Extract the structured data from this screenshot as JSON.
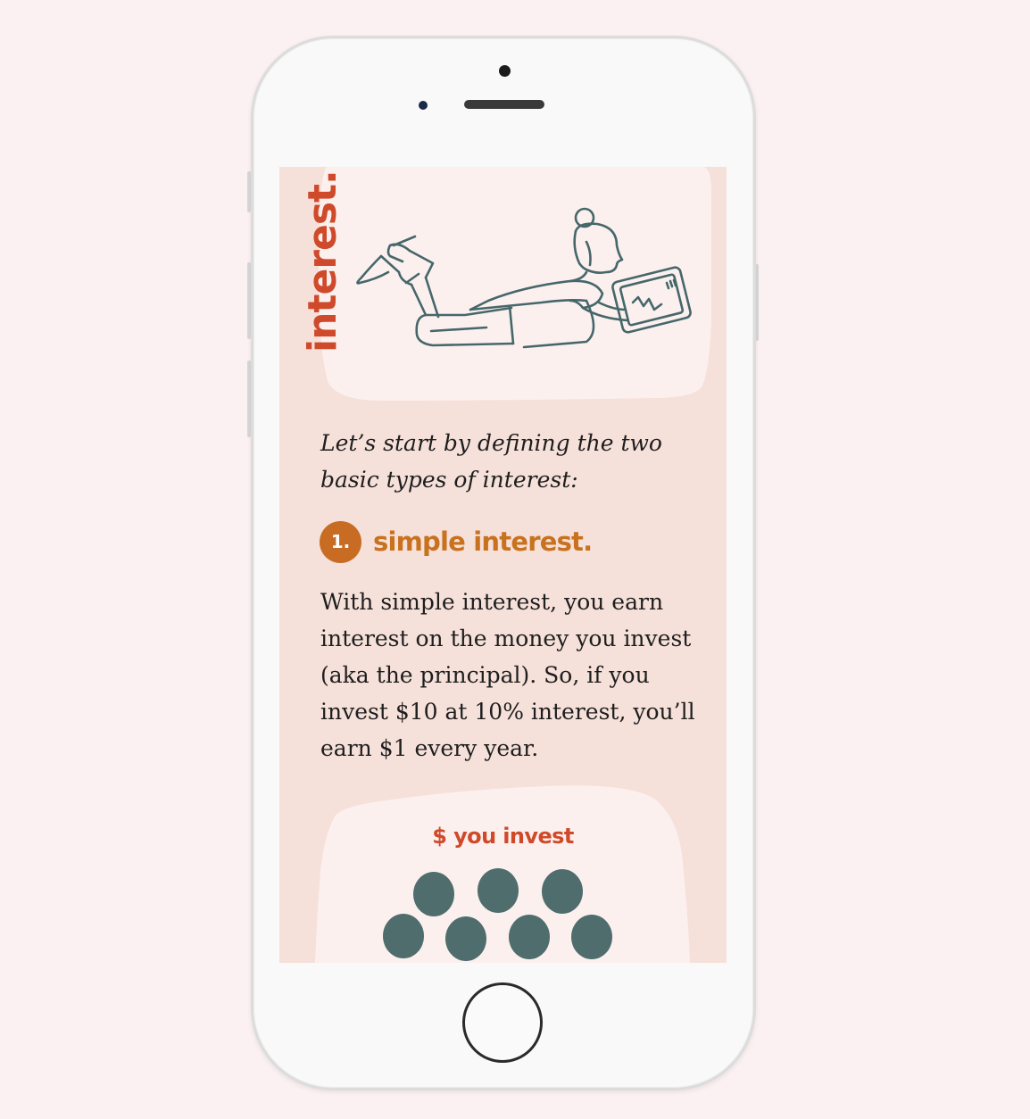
{
  "screen": {
    "vertical_title": "interest.",
    "intro": "Let’s start by defining the two basic types of interest:",
    "step": {
      "number": "1.",
      "title": "simple interest."
    },
    "body": "With simple interest, you earn interest on the money you invest (aka the principal). So, if you invest $10 at 10% interest, you’ll earn $1 every year.",
    "card": {
      "title": "$ you invest",
      "coin_count": 7
    }
  },
  "colors": {
    "background": "#fcf1f2",
    "screen_bg": "#f6e0da",
    "card_bg": "#fcf0ef",
    "accent_red": "#cf4a2a",
    "accent_orange": "#c86c24",
    "coin": "#4f6d6d",
    "line_art": "#46676a"
  },
  "icons": {
    "illustration": "woman-reading-tablet-illustration",
    "coins": "coin-stack-icon"
  }
}
